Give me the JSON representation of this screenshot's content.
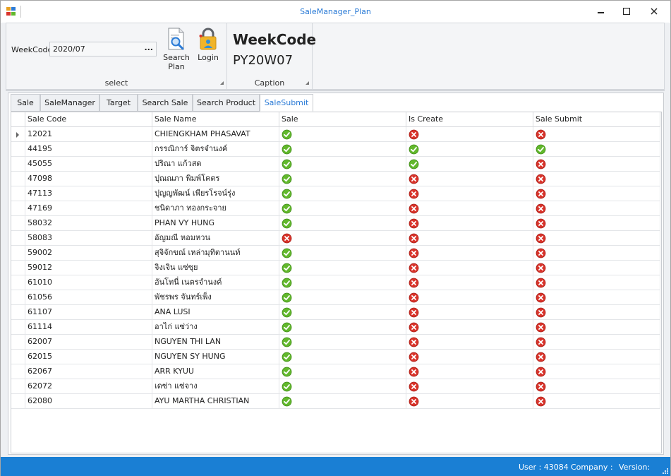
{
  "window": {
    "title": "SaleManager_Plan"
  },
  "ribbon": {
    "select_group": {
      "caption": "select",
      "weekcode_label": "WeekCode",
      "weekcode_value": "2020/07",
      "ellipsis": "...",
      "search_plan": "Search\nPlan",
      "login": "Login"
    },
    "caption_group": {
      "caption": "Caption",
      "title": "WeekCode",
      "value": "PY20W07"
    }
  },
  "tabs": [
    "Sale",
    "SaleManager",
    "Target",
    "Search Sale",
    "Search Product",
    "SaleSubmit"
  ],
  "active_tab": "SaleSubmit",
  "grid": {
    "columns": [
      "Sale Code",
      "Sale Name",
      "Sale",
      "Is Create",
      "Sale Submit"
    ],
    "rows": [
      {
        "code": "12021",
        "name": "CHIENGKHAM  PHASAVAT",
        "sale": "ok",
        "is_create": "no",
        "submit": "no"
      },
      {
        "code": "44195",
        "name": "กรรณิการ์ จิตรจำนงค์",
        "sale": "ok",
        "is_create": "ok",
        "submit": "ok"
      },
      {
        "code": "45055",
        "name": "ปริณา แก้วสด",
        "sale": "ok",
        "is_create": "ok",
        "submit": "no"
      },
      {
        "code": "47098",
        "name": "ปุณณภา พิมพ์โคตร",
        "sale": "ok",
        "is_create": "no",
        "submit": "no"
      },
      {
        "code": "47113",
        "name": "ปุญญพัฒน์ เพียรโรจน์รุ่ง",
        "sale": "ok",
        "is_create": "no",
        "submit": "no"
      },
      {
        "code": "47169",
        "name": "ชนิดาภา ทองกระจาย",
        "sale": "ok",
        "is_create": "no",
        "submit": "no"
      },
      {
        "code": "58032",
        "name": "PHAN VY HUNG",
        "sale": "ok",
        "is_create": "no",
        "submit": "no"
      },
      {
        "code": "58083",
        "name": "อัญมณี หอมหวน",
        "sale": "no",
        "is_create": "no",
        "submit": "no"
      },
      {
        "code": "59002",
        "name": "สุจิจักขณ์ เหล่ามุทิตานนท์",
        "sale": "ok",
        "is_create": "no",
        "submit": "no"
      },
      {
        "code": "59012",
        "name": "จิงเจิน แซ่ซุย",
        "sale": "ok",
        "is_create": "no",
        "submit": "no"
      },
      {
        "code": "61010",
        "name": "อันโทนี่ เนตรจำนงค์",
        "sale": "ok",
        "is_create": "no",
        "submit": "no"
      },
      {
        "code": "61056",
        "name": "พัชรพร จันทร์เพ็ง",
        "sale": "ok",
        "is_create": "no",
        "submit": "no"
      },
      {
        "code": "61107",
        "name": "ANA  LUSI",
        "sale": "ok",
        "is_create": "no",
        "submit": "no"
      },
      {
        "code": "61114",
        "name": "อาไก่ แซ่ว่าง",
        "sale": "ok",
        "is_create": "no",
        "submit": "no"
      },
      {
        "code": "62007",
        "name": "NGUYEN THI LAN",
        "sale": "ok",
        "is_create": "no",
        "submit": "no"
      },
      {
        "code": "62015",
        "name": "NGUYEN SY HUNG",
        "sale": "ok",
        "is_create": "no",
        "submit": "no"
      },
      {
        "code": "62067",
        "name": "ARR KYUU",
        "sale": "ok",
        "is_create": "no",
        "submit": "no"
      },
      {
        "code": "62072",
        "name": "เดซ่า แซ่จาง",
        "sale": "ok",
        "is_create": "no",
        "submit": "no"
      },
      {
        "code": "62080",
        "name": "AYU  MARTHA CHRISTIAN",
        "sale": "ok",
        "is_create": "no",
        "submit": "no"
      }
    ]
  },
  "status": {
    "user": "User : 43084",
    "company": "Company :",
    "version": "Version:"
  },
  "colors": {
    "accent": "#2b7bd6",
    "statusbar": "#1a7fd4",
    "ok": "#62b82c",
    "no": "#d9342b"
  },
  "icons": {
    "ok": "check-circle-icon",
    "no": "x-circle-icon"
  }
}
